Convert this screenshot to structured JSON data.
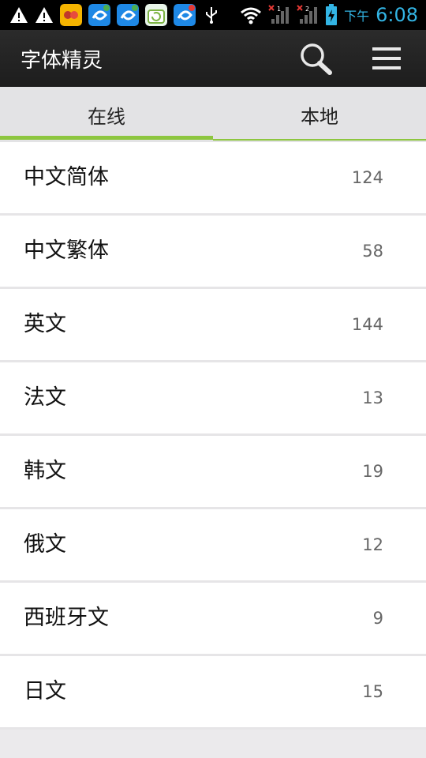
{
  "status_bar": {
    "time_period": "下午",
    "time": "6:08",
    "icons": [
      "warning-icon",
      "warning-icon",
      "qq-app-icon",
      "app-icon",
      "app-icon",
      "download-app-icon",
      "app-icon",
      "usb-icon",
      "wifi-icon",
      "signal-sim1-icon",
      "signal-sim2-icon",
      "battery-charging-icon"
    ],
    "sim_labels": [
      "1",
      "2"
    ]
  },
  "action_bar": {
    "title": "字体精灵",
    "search_icon": "search-icon",
    "menu_icon": "menu-icon"
  },
  "tabs": [
    {
      "label": "在线",
      "selected": true
    },
    {
      "label": "本地",
      "selected": false
    }
  ],
  "accent_color": "#8dc63f",
  "categories": [
    {
      "name": "中文简体",
      "count": "124"
    },
    {
      "name": "中文繁体",
      "count": "58"
    },
    {
      "name": "英文",
      "count": "144"
    },
    {
      "name": "法文",
      "count": "13"
    },
    {
      "name": "韩文",
      "count": "19"
    },
    {
      "name": "俄文",
      "count": "12"
    },
    {
      "name": "西班牙文",
      "count": "9"
    },
    {
      "name": "日文",
      "count": "15"
    }
  ]
}
